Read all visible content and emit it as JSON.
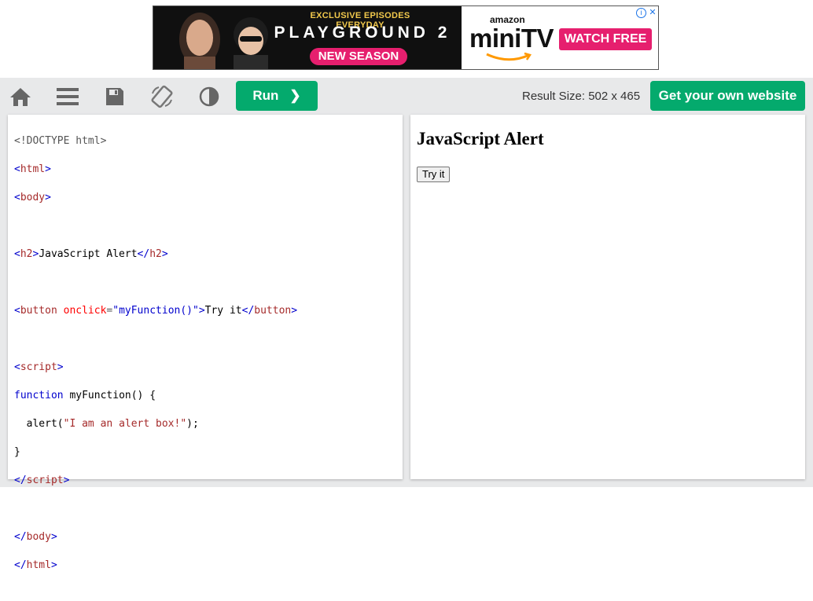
{
  "ad": {
    "tagline": "EXCLUSIVE EPISODES EVERYDAY",
    "show": "PLAYGROUND 2",
    "season": "NEW SEASON",
    "amazon": "amazon",
    "brand_mini": "mini",
    "brand_tv": "TV",
    "watch": "WATCH FREE",
    "info": "i",
    "close": "✕"
  },
  "toolbar": {
    "run_label": "Run",
    "run_chevron": "❯",
    "result_size": "Result Size: 502 x 465",
    "own_website": "Get your own website",
    "icons": [
      "home-icon",
      "menu-icon",
      "save-icon",
      "rotate-icon",
      "contrast-icon"
    ]
  },
  "code": {
    "line1": "<!DOCTYPE html>",
    "line2_open": "<",
    "line2_tag": "html",
    "line2_close": ">",
    "line3_open": "<",
    "line3_tag": "body",
    "line3_close": ">",
    "line5_open": "<",
    "line5_tag": "h2",
    "line5_gt": ">",
    "line5_text": "JavaScript Alert",
    "line5_end_open": "</",
    "line5_end_tag": "h2",
    "line5_end_close": ">",
    "line7_open": "<",
    "line7_tag": "button",
    "line7_attr": " onclick",
    "line7_eq": "=",
    "line7_val": "\"myFunction()\"",
    "line7_gt": ">",
    "line7_text": "Try it",
    "line7_end_open": "</",
    "line7_end_tag": "button",
    "line7_end_close": ">",
    "line9_open": "<",
    "line9_tag": "script",
    "line9_close": ">",
    "line10_kw": "function",
    "line10_rest": " myFunction() {",
    "line11_a": "  alert(",
    "line11_str": "\"I am an alert box!\"",
    "line11_b": ");",
    "line12": "}",
    "line13_open": "</",
    "line13_tag": "script",
    "line13_close": ">",
    "line15_open": "</",
    "line15_tag": "body",
    "line15_close": ">",
    "line16_open": "</",
    "line16_tag": "html",
    "line16_close": ">"
  },
  "result": {
    "heading": "JavaScript Alert",
    "button": "Try it"
  },
  "colors": {
    "accent": "#04aa6d",
    "toolbar_bg": "#e8e9ea",
    "ad_pink": "#e61f6e"
  }
}
